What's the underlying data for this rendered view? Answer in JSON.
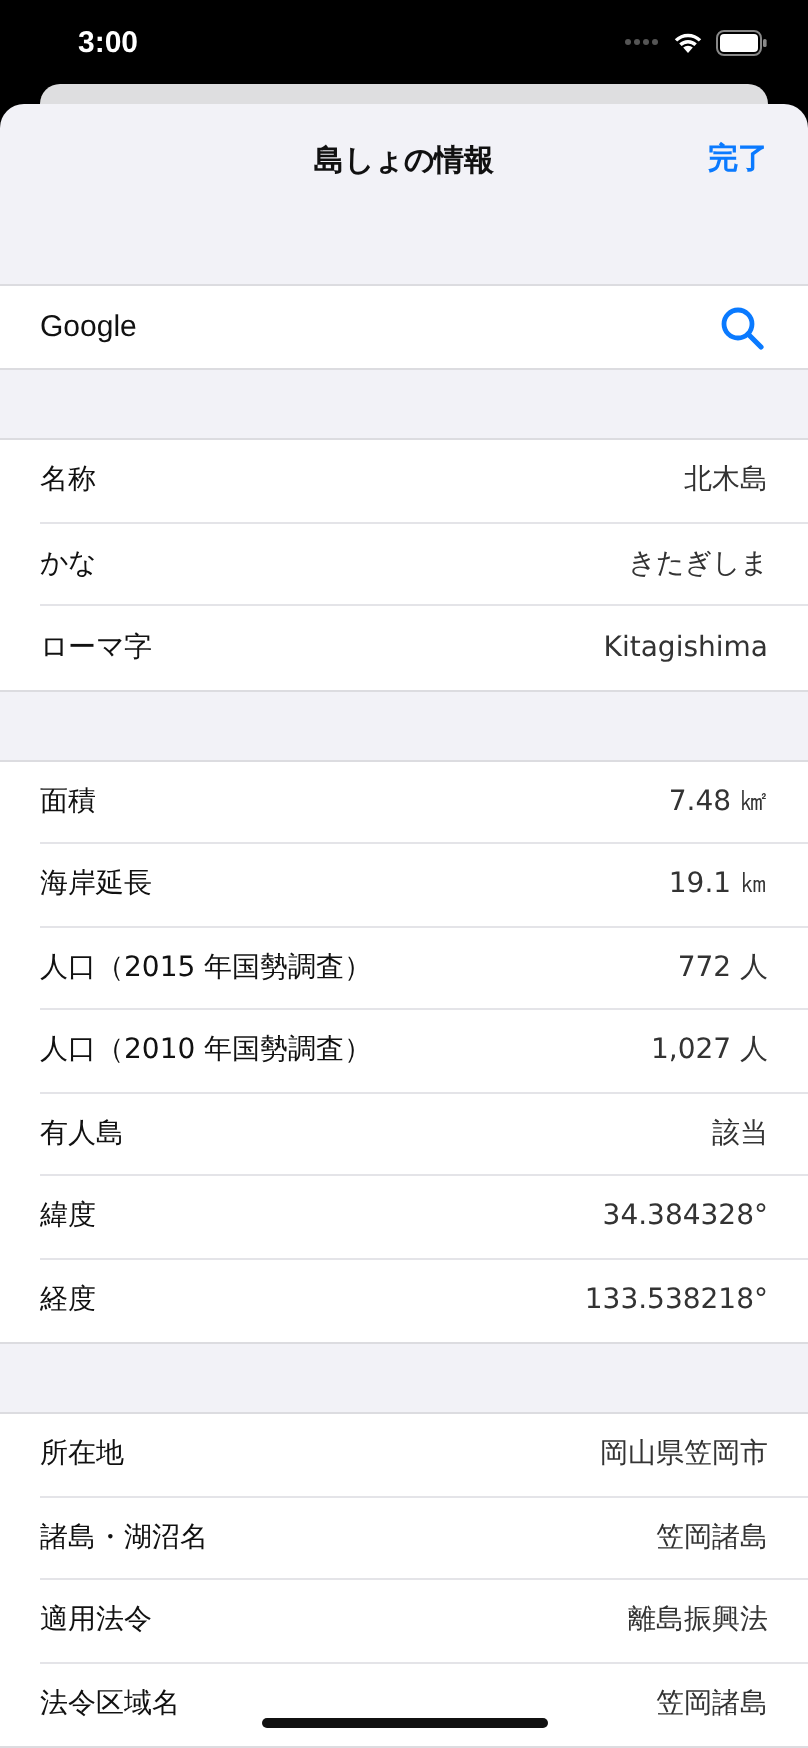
{
  "status_bar": {
    "time": "3:00"
  },
  "sheet": {
    "title": "島しょの情報",
    "done_button": "完了"
  },
  "search": {
    "value": "Google"
  },
  "sections": [
    {
      "rows": [
        {
          "label": "名称",
          "value": "北木島"
        },
        {
          "label": "かな",
          "value": "きたぎしま"
        },
        {
          "label": "ローマ字",
          "value": "Kitagishima"
        }
      ]
    },
    {
      "rows": [
        {
          "label": "面積",
          "value": "7.48 ㎢"
        },
        {
          "label": "海岸延長",
          "value": "19.1 ㎞"
        },
        {
          "label": "人口（2015 年国勢調査）",
          "value": "772 人"
        },
        {
          "label": "人口（2010 年国勢調査）",
          "value": "1,027 人"
        },
        {
          "label": "有人島",
          "value": "該当"
        },
        {
          "label": "緯度",
          "value": "34.384328°"
        },
        {
          "label": "経度",
          "value": "133.538218°"
        }
      ]
    },
    {
      "rows": [
        {
          "label": "所在地",
          "value": "岡山県笠岡市"
        },
        {
          "label": "諸島・湖沼名",
          "value": "笠岡諸島"
        },
        {
          "label": "適用法令",
          "value": "離島振興法"
        },
        {
          "label": "法令区域名",
          "value": "笠岡諸島"
        }
      ]
    }
  ]
}
